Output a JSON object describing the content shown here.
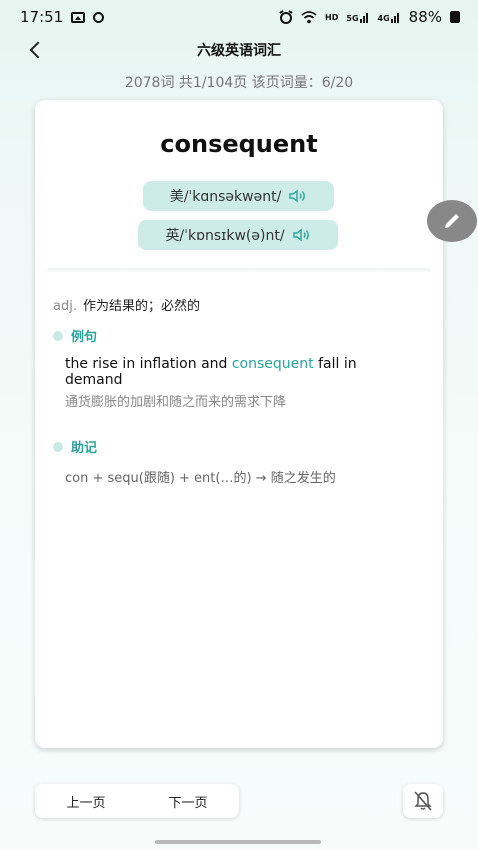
{
  "status_bar": {
    "time": "17:51",
    "hd": "HD",
    "net_5g": "5G",
    "net_4g": "4G",
    "battery": "88%"
  },
  "header": {
    "title": "六级英语词汇"
  },
  "meta": {
    "text": "2078词  共1/104页  该页词量：6/20"
  },
  "card": {
    "word": "consequent",
    "pron_us": "美/ˈkɑnsəkwənt/",
    "pron_uk": "英/ˈkɒnsɪkw(ə)nt/",
    "pos": "adj.",
    "definition": "作为结果的；必然的",
    "example_heading": "例句",
    "example_en_before": "the rise in inflation and ",
    "example_en_highlight": "consequent",
    "example_en_after": " fall in demand",
    "example_cn": "通货膨胀的加剧和随之而来的需求下降",
    "mnemonic_heading": "助记",
    "mnemonic": "con + sequ(跟随) + ent(…的) → 随之发生的"
  },
  "bottom": {
    "prev": "上一页",
    "next": "下一页"
  },
  "colors": {
    "accent": "#2aa39a",
    "pron_bg": "#cdece8"
  }
}
